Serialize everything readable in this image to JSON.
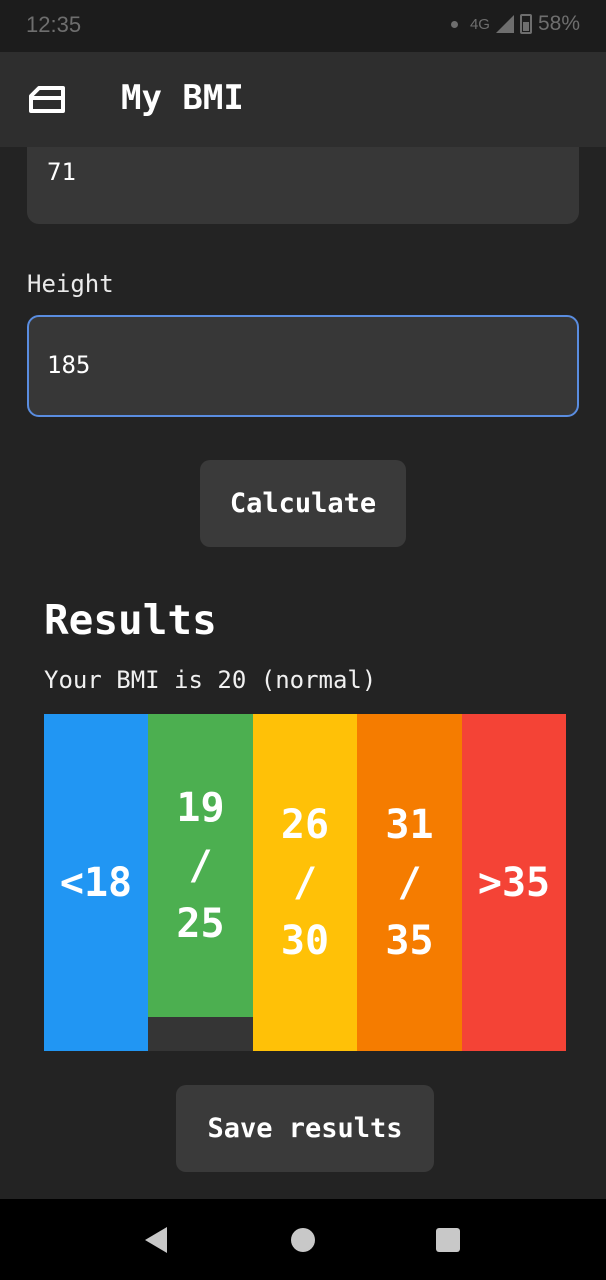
{
  "status_bar": {
    "time": "12:35",
    "network": "4G",
    "battery": "58%"
  },
  "app_bar": {
    "title": "My BMI",
    "icon": "home-icon"
  },
  "form": {
    "weight_value": "71",
    "height_label": "Height",
    "height_value": "185",
    "calculate_label": "Calculate"
  },
  "results": {
    "title": "Results",
    "summary": "Your BMI is 20 (normal)",
    "scale": [
      {
        "label": "<18",
        "color": "#2196f3"
      },
      {
        "label": "19\n/\n25",
        "color": "#4caf50"
      },
      {
        "label": "26\n/\n30",
        "color": "#ffc107"
      },
      {
        "label": "31\n/\n35",
        "color": "#f57c00"
      },
      {
        "label": ">35",
        "color": "#f44336"
      }
    ],
    "save_label": "Save results"
  },
  "nav_bar": {
    "back_icon": "back-icon",
    "home_icon": "home-circle-icon",
    "recents_icon": "recents-icon"
  }
}
